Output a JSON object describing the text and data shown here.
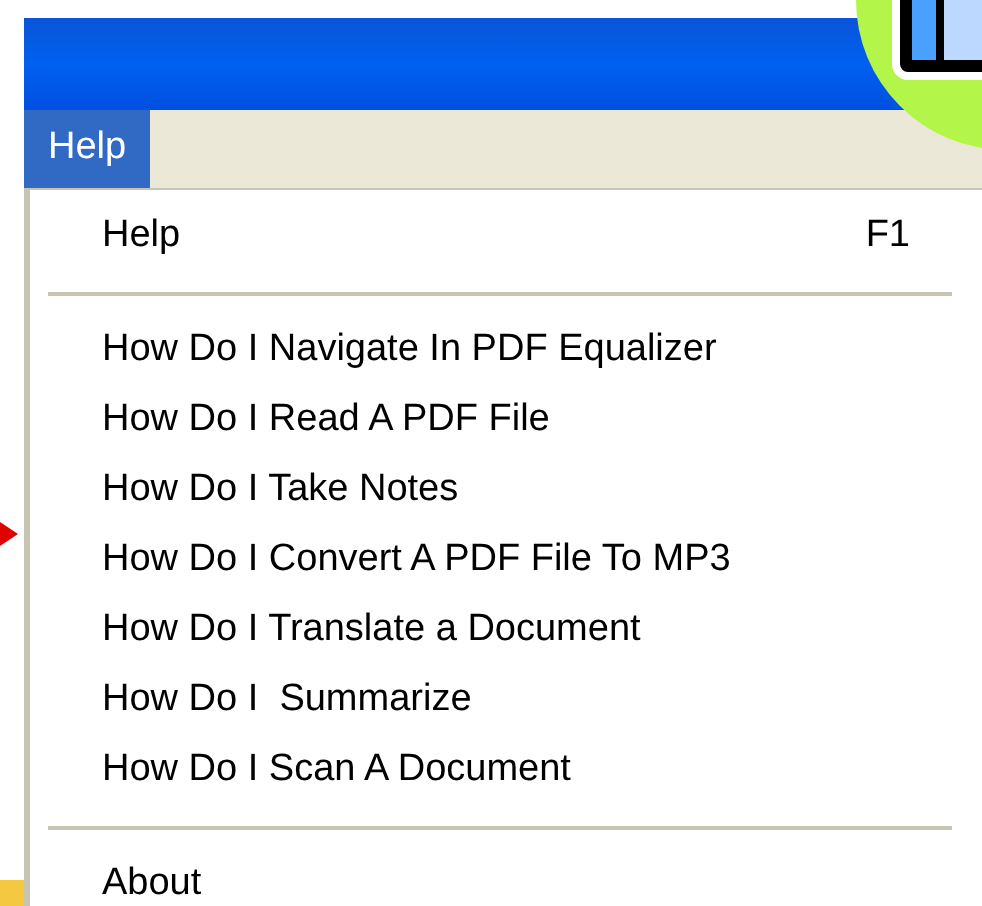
{
  "menu_bar": [
    {
      "label": "Help",
      "selected": true
    }
  ],
  "menu": [
    {
      "kind": "item",
      "label": "Help",
      "shortcut": "F1"
    },
    {
      "kind": "separator"
    },
    {
      "kind": "item",
      "label": "How Do I Navigate In PDF Equalizer"
    },
    {
      "kind": "item",
      "label": "How Do I Read A PDF File"
    },
    {
      "kind": "item",
      "label": "How Do I Take Notes"
    },
    {
      "kind": "item",
      "label": "How Do I Convert A PDF File To MP3"
    },
    {
      "kind": "item",
      "label": "How Do I Translate a Document"
    },
    {
      "kind": "item",
      "label": "How Do I  Summarize"
    },
    {
      "kind": "item",
      "label": "How Do I Scan A Document"
    },
    {
      "kind": "separator"
    },
    {
      "kind": "item",
      "label": "About"
    }
  ]
}
